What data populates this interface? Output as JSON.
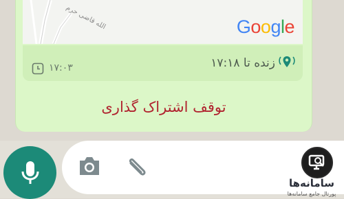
{
  "map": {
    "street_name": "الله قاضی حرم",
    "brand": [
      "G",
      "o",
      "o",
      "g",
      "l",
      "e"
    ],
    "brand_colors": [
      "#4285F4",
      "#EA4335",
      "#FBBC05",
      "#4285F4",
      "#34A853",
      "#EA4335"
    ]
  },
  "location": {
    "live_text": "زنده تا ۱۷:۱۸",
    "sent_time": "۱۷:۰۳",
    "stop_label": "توقف اشتراک گذاری",
    "stop_color": "#b0232f",
    "live_icon": "live-location-pin-icon"
  },
  "composer": {
    "mic_icon": "mic-icon",
    "camera_icon": "camera-icon",
    "attach_icon": "paperclip-icon",
    "accent": "#1c8a78"
  },
  "watermark": {
    "title": "سامانه‌ها",
    "subtitle": "پورتال جامع سامانه‌ها"
  }
}
